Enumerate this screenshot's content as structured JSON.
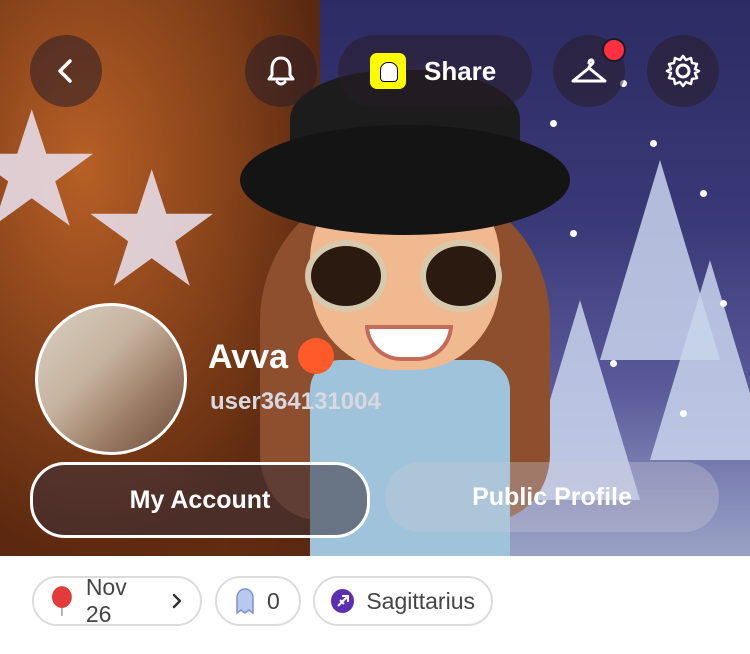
{
  "header": {
    "back_icon": "chevron-left-icon",
    "notification_icon": "bell-icon",
    "share_label": "Share",
    "snapcode_icon": "snapcode-icon",
    "outfit_icon": "hanger-icon",
    "settings_icon": "gear-icon",
    "notification_dot_color": "#ff3040"
  },
  "profile": {
    "display_name": "Avva",
    "display_emoji": "🥵",
    "username": "user364131004"
  },
  "actions": {
    "my_account_label": "My Account",
    "public_profile_label": "Public Profile"
  },
  "chips": {
    "birthday": "Nov 26",
    "birthday_icon": "balloon-icon",
    "friends_count": "0",
    "friends_icon": "ghost-icon",
    "zodiac": "Sagittarius",
    "zodiac_icon": "sagittarius-icon"
  },
  "colors": {
    "snapchat_yellow": "#fffc00",
    "zodiac_purple": "#5b2fb0",
    "balloon_red": "#e33a3a"
  }
}
